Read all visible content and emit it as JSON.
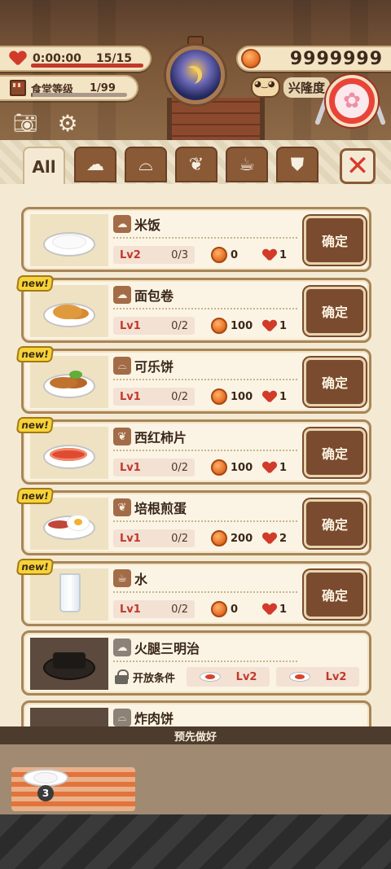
{
  "hud": {
    "timer": "0:00:00",
    "hearts": "15/15",
    "hearts_fraction": 1.0,
    "cafeteria_label": "食堂等级",
    "cafeteria_level": "1/99",
    "cafeteria_fraction": 0.01,
    "coins": "9999999",
    "prosperity_label": "兴隆度"
  },
  "tabs": [
    {
      "label": "All",
      "icon": "all",
      "active": true
    },
    {
      "label": "",
      "icon": "rice-icon"
    },
    {
      "label": "",
      "icon": "cloche-icon"
    },
    {
      "label": "",
      "icon": "salad-icon"
    },
    {
      "label": "",
      "icon": "cup-icon"
    },
    {
      "label": "",
      "icon": "pudding-icon"
    }
  ],
  "dishes": [
    {
      "name": "米饭",
      "level": "Lv2",
      "qty": "0/3",
      "cost": "0",
      "hearts": "1",
      "new": false,
      "button": "确定"
    },
    {
      "name": "面包卷",
      "level": "Lv1",
      "qty": "0/2",
      "cost": "100",
      "hearts": "1",
      "new": true,
      "new_label": "new!",
      "button": "确定"
    },
    {
      "name": "可乐饼",
      "level": "Lv1",
      "qty": "0/2",
      "cost": "100",
      "hearts": "1",
      "new": true,
      "new_label": "new!",
      "button": "确定"
    },
    {
      "name": "西红柿片",
      "level": "Lv1",
      "qty": "0/2",
      "cost": "100",
      "hearts": "1",
      "new": true,
      "new_label": "new!",
      "button": "确定"
    },
    {
      "name": "培根煎蛋",
      "level": "Lv1",
      "qty": "0/2",
      "cost": "200",
      "hearts": "2",
      "new": true,
      "new_label": "new!",
      "button": "确定"
    },
    {
      "name": "水",
      "level": "Lv1",
      "qty": "0/2",
      "cost": "0",
      "hearts": "1",
      "new": true,
      "new_label": "new!",
      "button": "确定"
    }
  ],
  "locked_dish": {
    "name": "火腿三明治",
    "unlock_label": "开放条件",
    "requirements": [
      "Lv2",
      "Lv2"
    ]
  },
  "partial_dish": {
    "name": "炸肉饼"
  },
  "bottom": {
    "prepare_label": "预先做好",
    "plate_count": "3"
  },
  "colors": {
    "accent_red": "#c0392b",
    "button_brown": "#7a4b2e",
    "badge_yellow": "#f7d33b"
  }
}
